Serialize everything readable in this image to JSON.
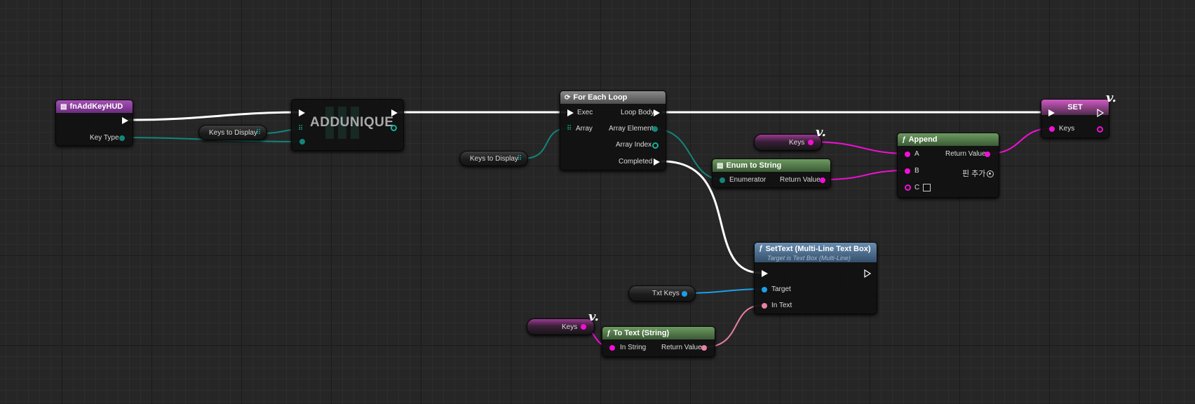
{
  "nodes": {
    "event": {
      "title": "fnAddKeyHUD",
      "key_type": "Key Type"
    },
    "addunique": {
      "title": "ADDUNIQUE"
    },
    "keys_display_1": {
      "label": "Keys to Display"
    },
    "keys_display_2": {
      "label": "Keys to Display"
    },
    "foreach": {
      "title": "For Each Loop",
      "exec": "Exec",
      "array": "Array",
      "loop_body": "Loop Body",
      "array_element": "Array Element",
      "array_index": "Array Index",
      "completed": "Completed"
    },
    "enum_to_string": {
      "title": "Enum to String",
      "enumerator": "Enumerator",
      "return_value": "Return Value"
    },
    "keys_get_1": {
      "label": "Keys"
    },
    "append": {
      "title": "Append",
      "a": "A",
      "b": "B",
      "c": "C",
      "return_value": "Return Value",
      "add_pin": "핀 추가"
    },
    "set": {
      "title": "SET",
      "keys": "Keys"
    },
    "settext": {
      "title": "SetText (Multi-Line Text Box)",
      "subtitle": "Target is Text Box (Multi-Line)",
      "target": "Target",
      "in_text": "In Text"
    },
    "txt_keys": {
      "label": "Txt Keys"
    },
    "keys_get_2": {
      "label": "Keys"
    },
    "to_text": {
      "title": "To Text (String)",
      "in_string": "In String",
      "return_value": "Return Value"
    }
  },
  "colors": {
    "exec_wire": "#ffffff",
    "array_wire": "#14857a",
    "string_wire": "#f20fd6",
    "object_wire": "#1d9fe8",
    "text_wire": "#e87fa6"
  },
  "icons": {
    "event": "event-graph-icon",
    "foreach": "loop-icon",
    "enum": "enum-icon",
    "function": "function-icon",
    "var_marker": "variable-get-marker-icon"
  }
}
